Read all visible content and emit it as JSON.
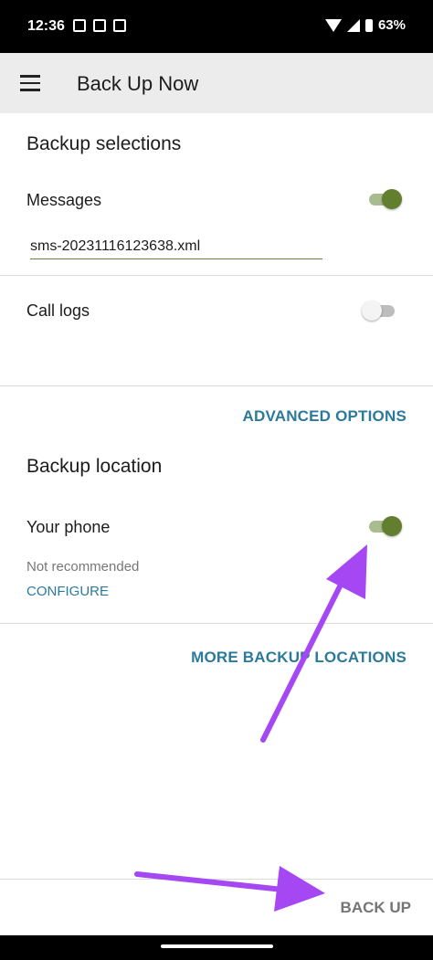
{
  "status_bar": {
    "time": "12:36",
    "battery": "63%"
  },
  "app_bar": {
    "title": "Back Up Now"
  },
  "backup_selections": {
    "title": "Backup selections",
    "messages": {
      "label": "Messages",
      "enabled": true,
      "filename": "sms-20231116123638.xml"
    },
    "call_logs": {
      "label": "Call logs",
      "enabled": false
    },
    "advanced_options": "ADVANCED OPTIONS"
  },
  "backup_location": {
    "title": "Backup location",
    "your_phone": {
      "label": "Your phone",
      "enabled": true,
      "note": "Not recommended",
      "configure": "CONFIGURE"
    },
    "more_locations": "MORE BACKUP LOCATIONS"
  },
  "bottom": {
    "back_up": "BACK UP"
  },
  "colors": {
    "accent": "#2b7a9c",
    "toggle_on": "#627f2f",
    "annotation_arrow": "#a547f2"
  },
  "icons": [
    "hamburger-menu-icon",
    "wifi-icon",
    "signal-icon",
    "battery-icon"
  ]
}
